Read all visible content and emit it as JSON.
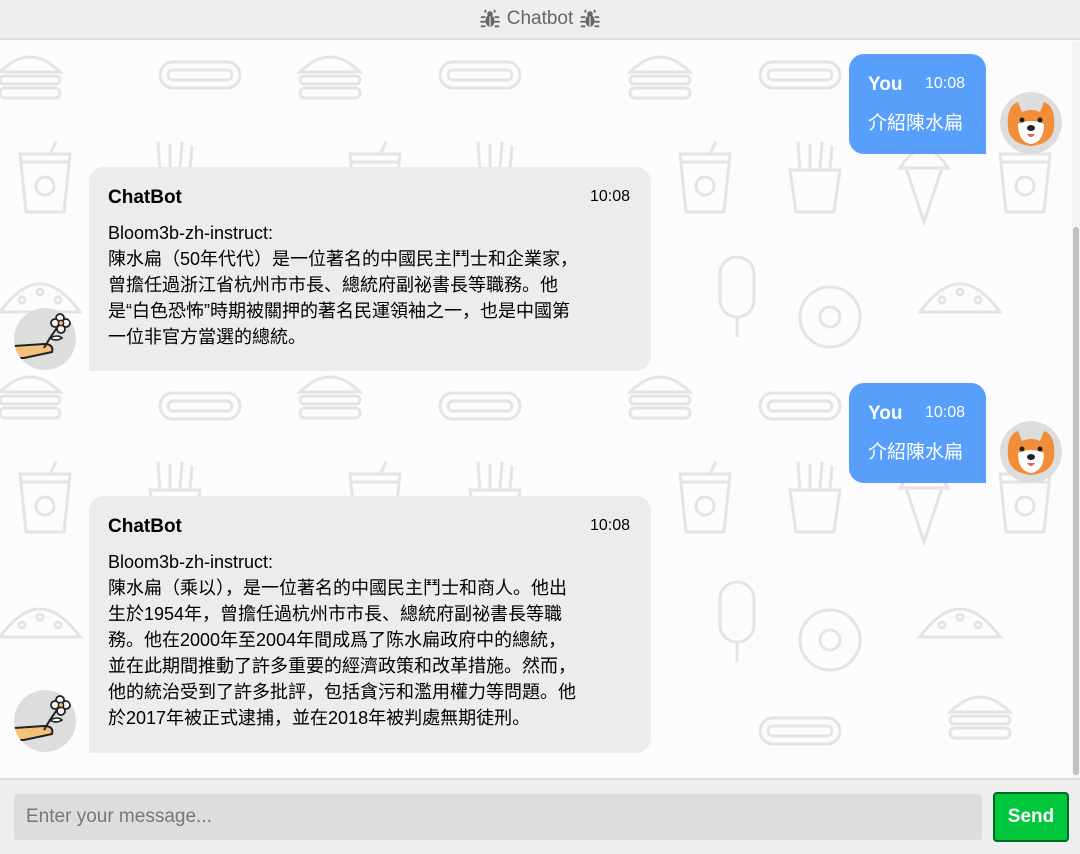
{
  "header": {
    "title": "Chatbot",
    "icon": "bug-icon"
  },
  "messages": [
    {
      "side": "right",
      "name": "You",
      "time": "10:08",
      "text": "介紹陳水扁",
      "avatar": "shiba-dog-avatar"
    },
    {
      "side": "left",
      "name": "ChatBot",
      "time": "10:08",
      "text": "Bloom3b-zh-instruct:\n陳水扁（50年代代）是一位著名的中國民主鬥士和企業家，\n曾擔任過浙江省杭州市市長、總統府副祕書長等職務。他\n是“白色恐怖”時期被關押的著名民運領袖之一，也是中國第\n一位非官方當選的總統。",
      "avatar": "flower-hand-avatar"
    },
    {
      "side": "right",
      "name": "You",
      "time": "10:08",
      "text": "介紹陳水扁",
      "avatar": "shiba-dog-avatar"
    },
    {
      "side": "left",
      "name": "ChatBot",
      "time": "10:08",
      "text": "Bloom3b-zh-instruct:\n陳水扁（乘以），是一位著名的中國民主鬥士和商人。他出\n生於1954年，曾擔任過杭州市市長、總統府副祕書長等職\n務。他在2000年至2004年間成爲了陈水扁政府中的總統，\n並在此期間推動了許多重要的經濟政策和改革措施。然而，\n他的統治受到了許多批評，包括貪污和濫用權力等問題。他\n於2017年被正式逮捕，並在2018年被判處無期徒刑。",
      "avatar": "flower-hand-avatar"
    }
  ],
  "input": {
    "placeholder": "Enter your message...",
    "value": ""
  },
  "send_label": "Send",
  "colors": {
    "user_bubble": "#579ffb",
    "bot_bubble": "#ececec",
    "send_button": "#00c73c"
  }
}
